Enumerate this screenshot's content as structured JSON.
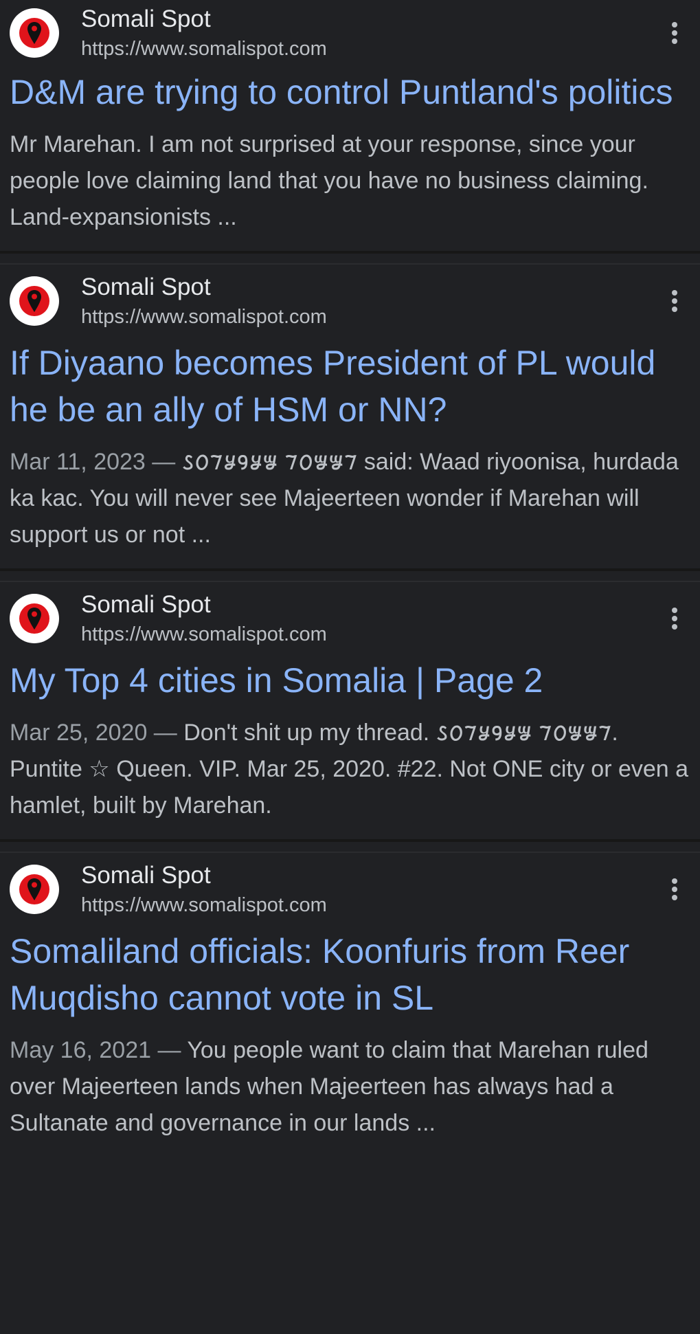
{
  "results": [
    {
      "site_name": "Somali Spot",
      "url": "https://www.somalispot.com",
      "title": "D&M are trying to control Puntland's politics",
      "date": "",
      "snippet": "Mr Marehan. I am not surprised at your response, since your people love claiming land that you have no business claiming. Land-expansionists ..."
    },
    {
      "site_name": "Somali Spot",
      "url": "https://www.somalispot.com",
      "title": "If Diyaano becomes President of PL would he be an ally of HSM or NN?",
      "date": "Mar 11, 2023 — ",
      "snippet": "𐒖𐒆𐒇𐒋𐒘𐒋𐒁 𐒇𐒆𐒁𐒁𐒇 said: Waad riyoonisa, hurdada ka kac. You will never see Majeerteen wonder if Marehan will support us or not ..."
    },
    {
      "site_name": "Somali Spot",
      "url": "https://www.somalispot.com",
      "title": "My Top 4 cities in Somalia | Page 2",
      "date": "Mar 25, 2020 — ",
      "snippet": "Don't shit up my thread. 𐒖𐒆𐒇𐒋𐒘𐒋𐒁 𐒇𐒆𐒁𐒁𐒇. Puntite ☆ Queen. VIP. Mar 25, 2020. #22. Not ONE city or even a hamlet, built by Marehan."
    },
    {
      "site_name": "Somali Spot",
      "url": "https://www.somalispot.com",
      "title": "Somaliland officials: Koonfuris from Reer Muqdisho cannot vote in SL",
      "date": "May 16, 2021 — ",
      "snippet": "You people want to claim that Marehan ruled over Majeerteen lands when Majeerteen has always had a Sultanate and governance in our lands ..."
    }
  ],
  "icons": {
    "favicon": "map-pin-icon",
    "more": "more-vert-icon"
  },
  "colors": {
    "background": "#202124",
    "title_link": "#8ab4f8",
    "snippet_text": "#bdc1c6",
    "favicon_red": "#e0141b"
  }
}
